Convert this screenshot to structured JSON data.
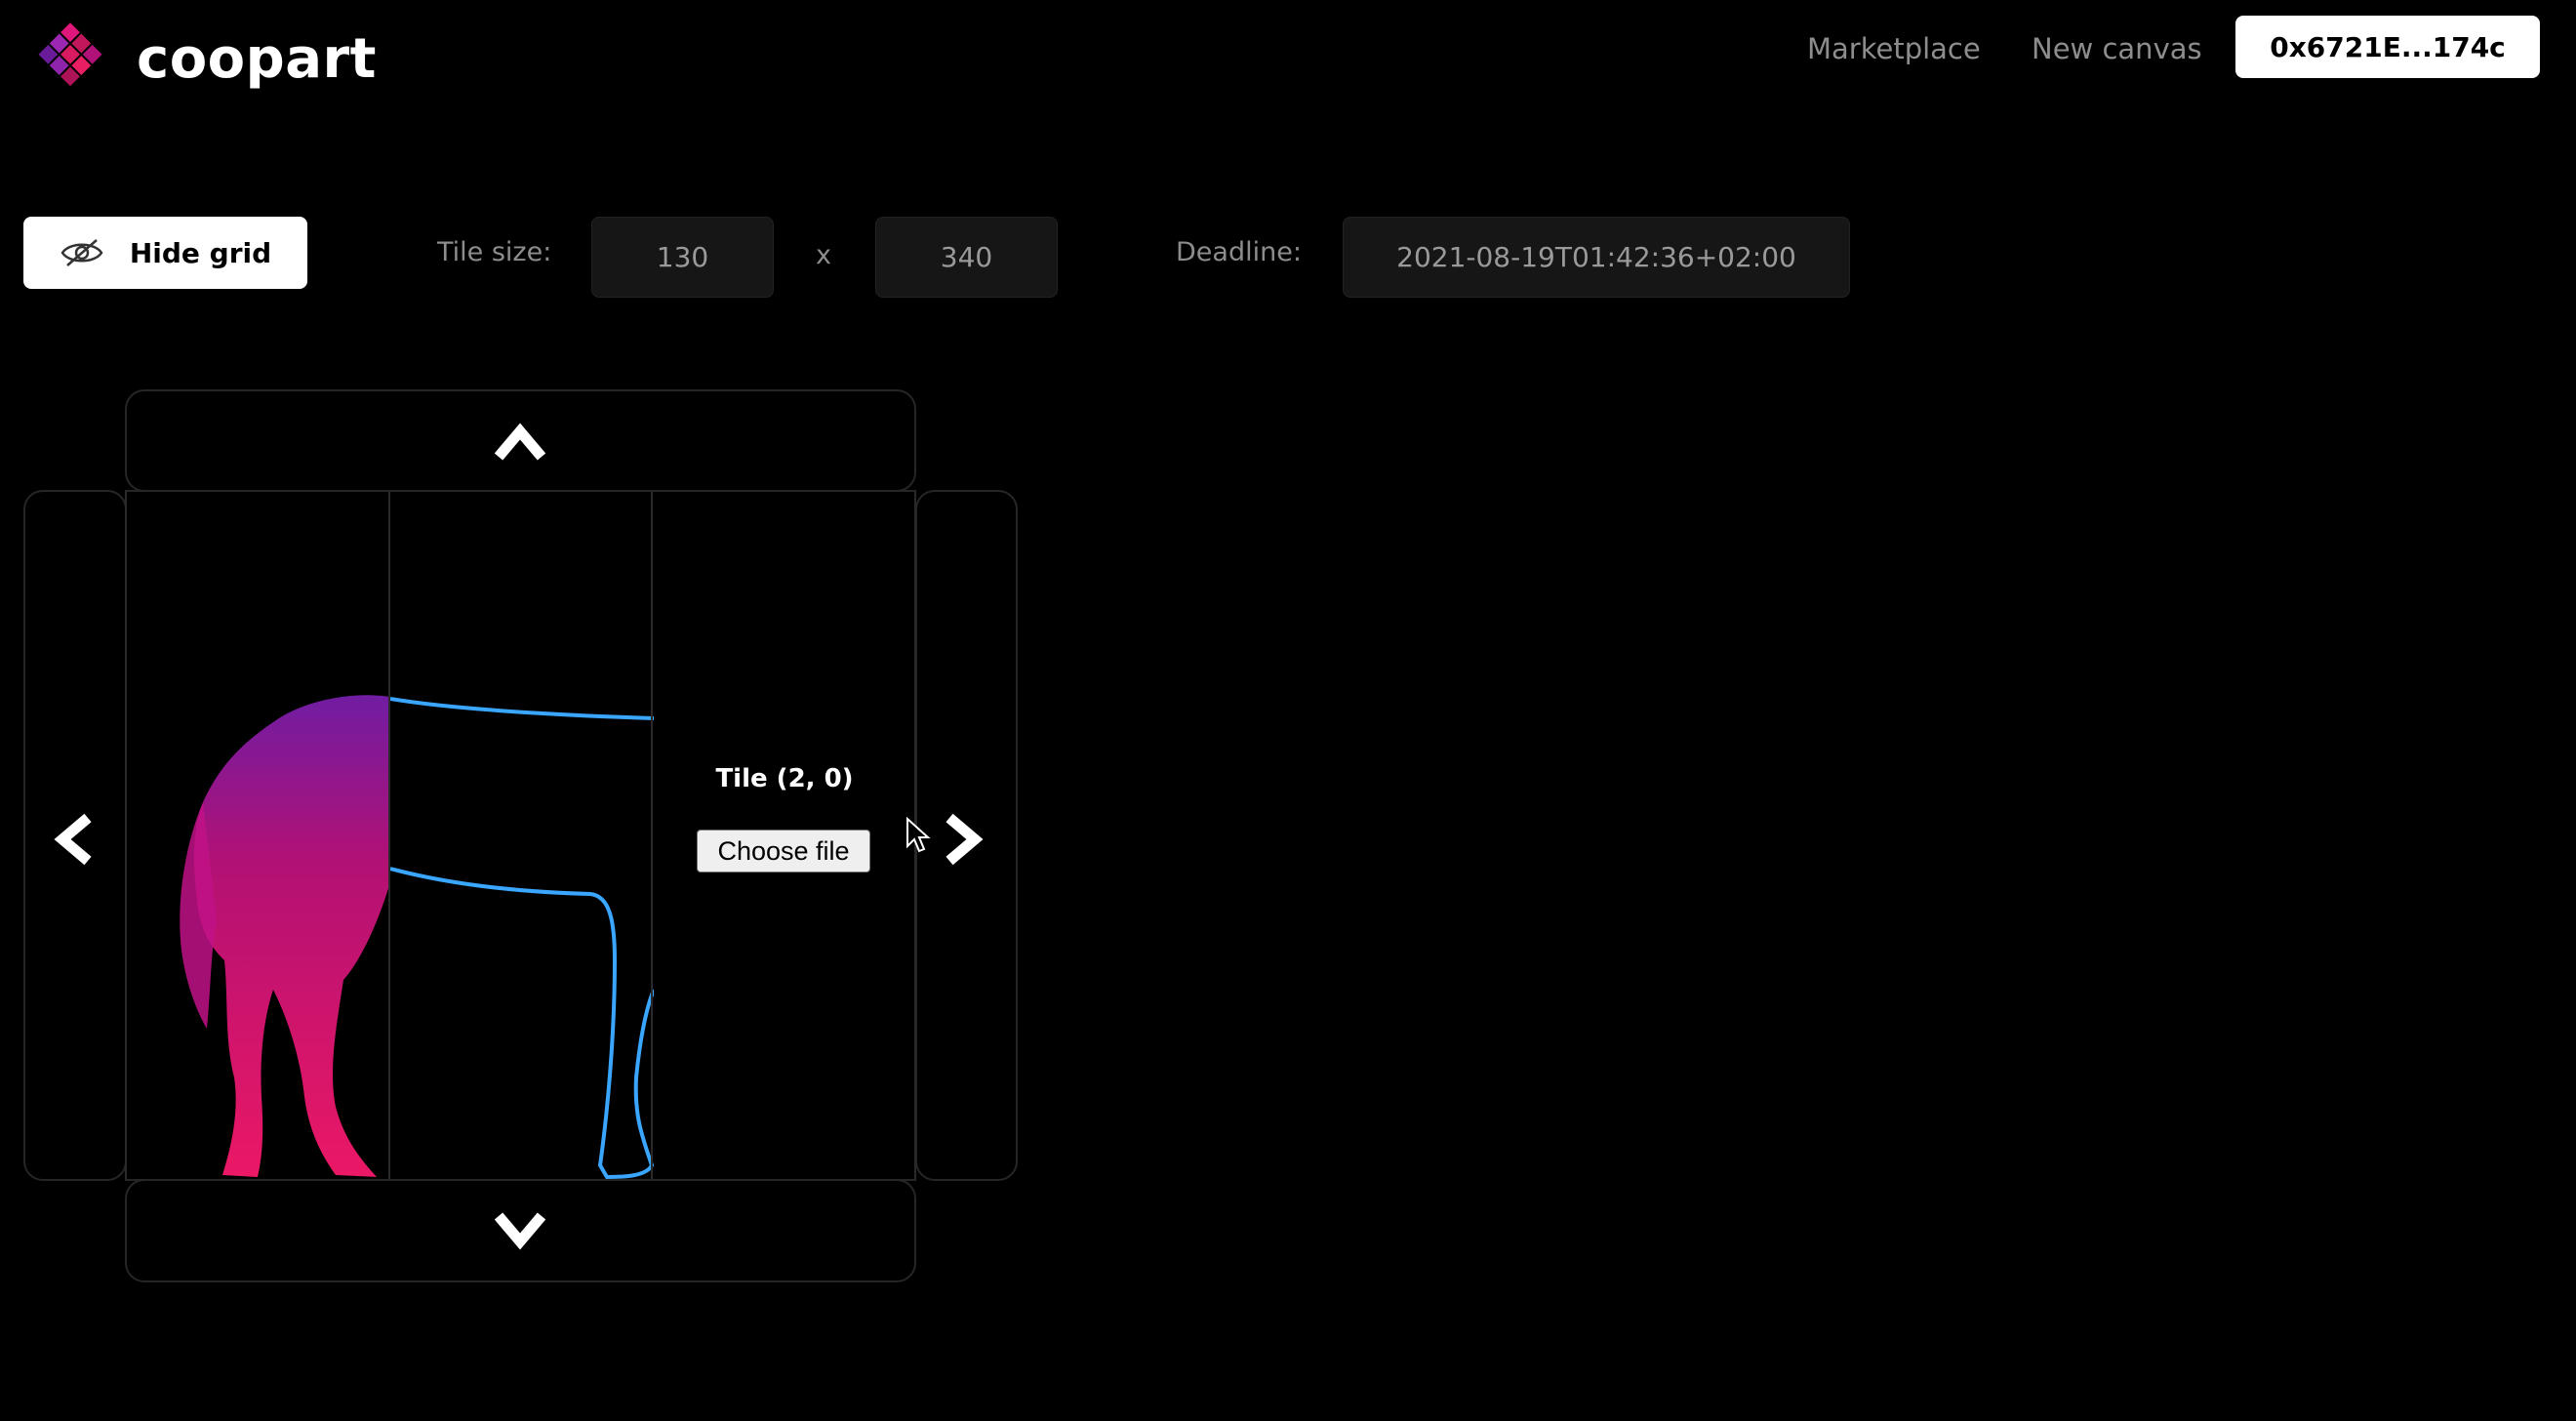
{
  "header": {
    "logo_text": "coopart",
    "nav": {
      "marketplace": "Marketplace",
      "new_canvas": "New canvas"
    },
    "wallet_address": "0x6721E...174c"
  },
  "toolbar": {
    "hide_grid_label": "Hide grid",
    "tile_size_label": "Tile size:",
    "tile_width": "130",
    "times_symbol": "x",
    "tile_height": "340",
    "deadline_label": "Deadline:",
    "deadline_value": "2021-08-19T01:42:36+02:00"
  },
  "canvas": {
    "selected_tile_label": "Tile (2, 0)",
    "choose_file_label": "Choose file"
  },
  "colors": {
    "brand_pink": "#e0177a",
    "brand_purple": "#7b1fa2",
    "horse_magenta": "#e0106f",
    "horse_blue": "#3aa6ff"
  }
}
